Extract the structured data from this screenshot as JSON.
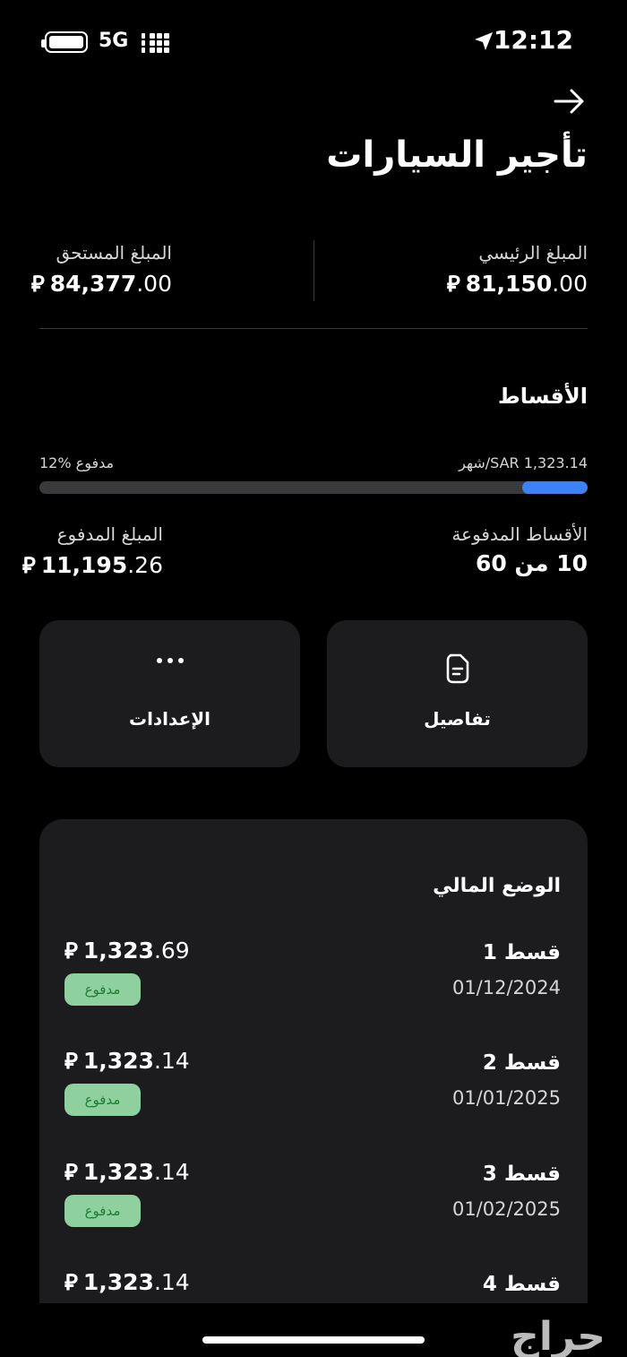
{
  "status_bar": {
    "network": "5G",
    "time": "12:12"
  },
  "header": {
    "title": "تأجير السيارات"
  },
  "amounts": {
    "principal_label": "المبلغ الرئيسي",
    "principal_int": "81,150",
    "principal_dec": ".00",
    "due_label": "المبلغ المستحق",
    "due_int": "84,377",
    "due_dec": ".00",
    "currency_symbol": "⃁"
  },
  "installments_section": {
    "title": "الأقساط",
    "monthly_label": "SAR 1,323.14/شهر",
    "paid_percent_label": "12% مدفوع",
    "progress_fraction": 0.12,
    "paid_count_label": "الأقساط المدفوعة",
    "paid_count_value": "10 من 60",
    "paid_amount_label": "المبلغ المدفوع",
    "paid_amount_int": "11,195",
    "paid_amount_dec": ".26"
  },
  "actions": {
    "details_label": "تفاصيل",
    "settings_label": "الإعدادات"
  },
  "financial_status": {
    "title": "الوضع المالي",
    "installments": [
      {
        "name": "قسط 1",
        "date": "01/12/2024",
        "amount_int": "1,323",
        "amount_dec": ".69",
        "status": "مدفوع"
      },
      {
        "name": "قسط 2",
        "date": "01/01/2025",
        "amount_int": "1,323",
        "amount_dec": ".14",
        "status": "مدفوع"
      },
      {
        "name": "قسط 3",
        "date": "01/02/2025",
        "amount_int": "1,323",
        "amount_dec": ".14",
        "status": "مدفوع"
      },
      {
        "name": "قسط 4",
        "date": "",
        "amount_int": "1,323",
        "amount_dec": ".14",
        "status": ""
      }
    ]
  },
  "watermark": "حراج",
  "colors": {
    "background": "#000000",
    "card": "#1c1c1e",
    "progress_fill": "#3b82f6",
    "badge_bg": "#8fd19e",
    "badge_text": "#1e7e34"
  }
}
